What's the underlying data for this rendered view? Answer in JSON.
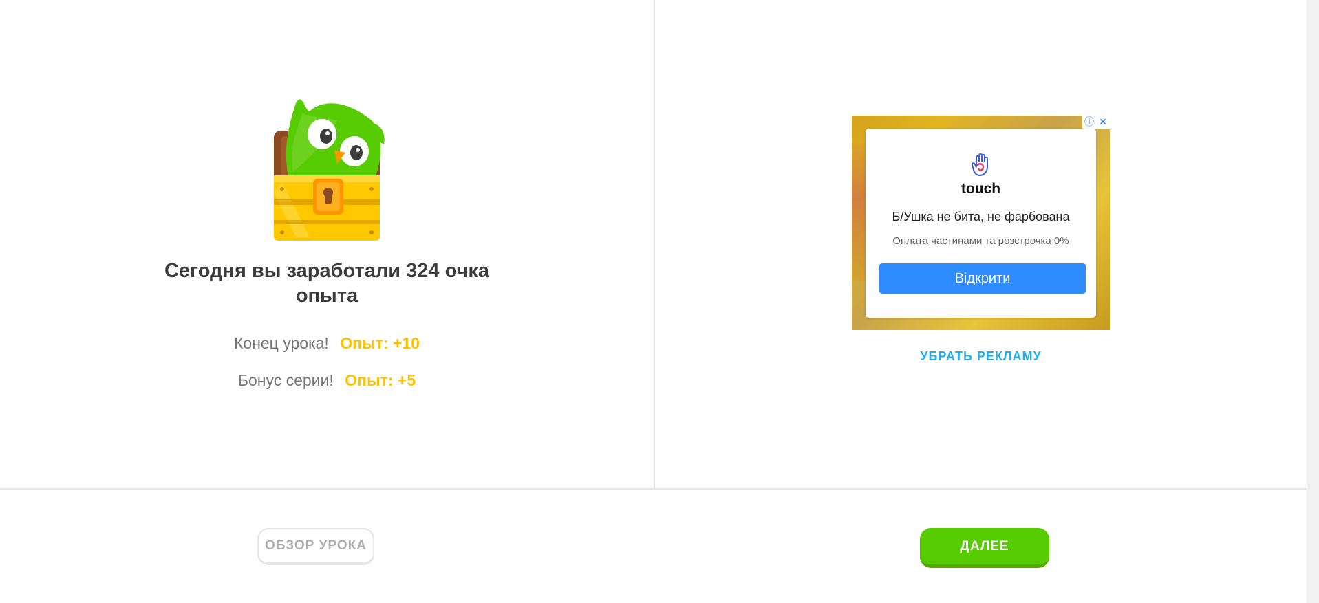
{
  "lesson_complete": {
    "headline": "Сегодня вы заработали 324 очка опыта",
    "rewards": [
      {
        "label": "Конец урока!",
        "value": "Опыт: +10"
      },
      {
        "label": "Бонус серии!",
        "value": "Опыт: +5"
      }
    ],
    "illustration": "owl-in-treasure-chest-illustration"
  },
  "ad": {
    "brand": "touch",
    "title": "Б/Ушка не бита, не фарбована",
    "subtitle": "Оплата частинами та розстрочка 0%",
    "cta": "Відкрити",
    "info_icon": "info-icon",
    "close_icon": "close-icon",
    "remove_ads_label": "УБРАТЬ РЕКЛАМУ"
  },
  "footer": {
    "review_label": "ОБЗОР УРОКА",
    "next_label": "ДАЛЕЕ"
  },
  "colors": {
    "accent_green": "#58cc02",
    "xp_gold": "#ffc200",
    "link_blue": "#1cb0f6",
    "ad_button_blue": "#2f8cff"
  }
}
